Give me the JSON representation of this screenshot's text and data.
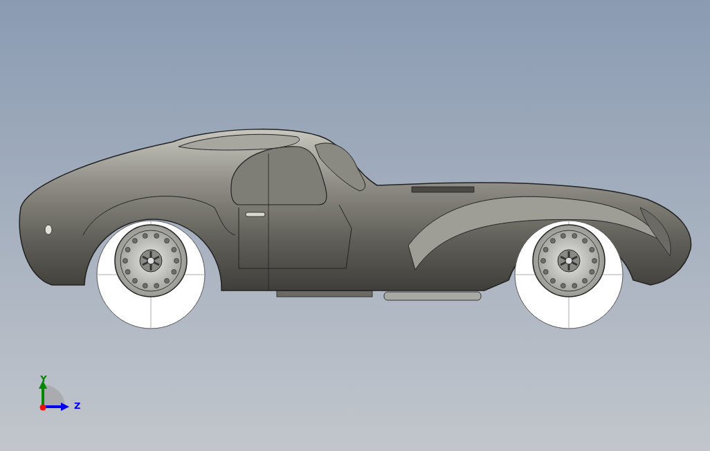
{
  "triad": {
    "axes": [
      {
        "label": "Y",
        "color": "#008800",
        "kind": "vertical"
      },
      {
        "label": "Z",
        "color": "#0000ee",
        "kind": "horizontal"
      }
    ]
  }
}
